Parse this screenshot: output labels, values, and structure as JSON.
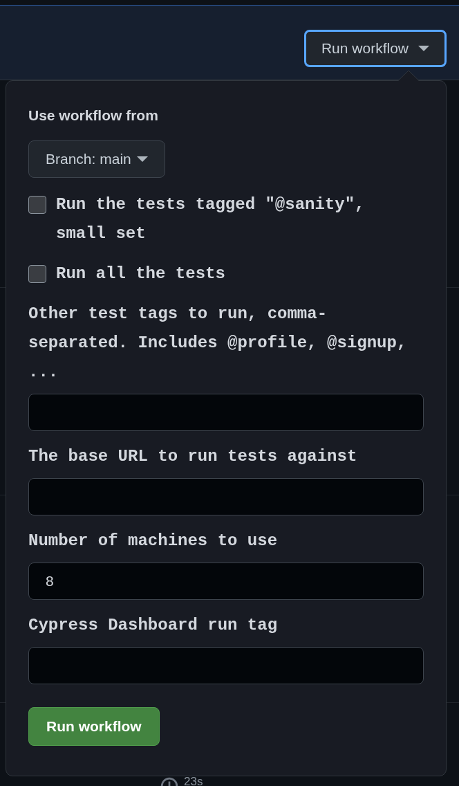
{
  "header": {
    "run_button": "Run workflow"
  },
  "popup": {
    "title": "Use workflow from",
    "branch_button": "Branch: main",
    "inputs": [
      {
        "kind": "checkbox",
        "label": "Run the tests tagged \"@sanity\", small set",
        "checked": false
      },
      {
        "kind": "checkbox",
        "label": "Run all the tests",
        "checked": false
      },
      {
        "kind": "text",
        "label": "Other test tags to run, comma-separated. Includes @profile, @signup, ..."
      },
      {
        "kind": "text",
        "label": "The base URL to run tests against"
      },
      {
        "kind": "text",
        "label": "Number of machines to use",
        "value": "8"
      },
      {
        "kind": "text",
        "label": "Cypress Dashboard run tag"
      }
    ],
    "submit_button": "Run workflow"
  },
  "background_row": {
    "duration": "23s"
  }
}
